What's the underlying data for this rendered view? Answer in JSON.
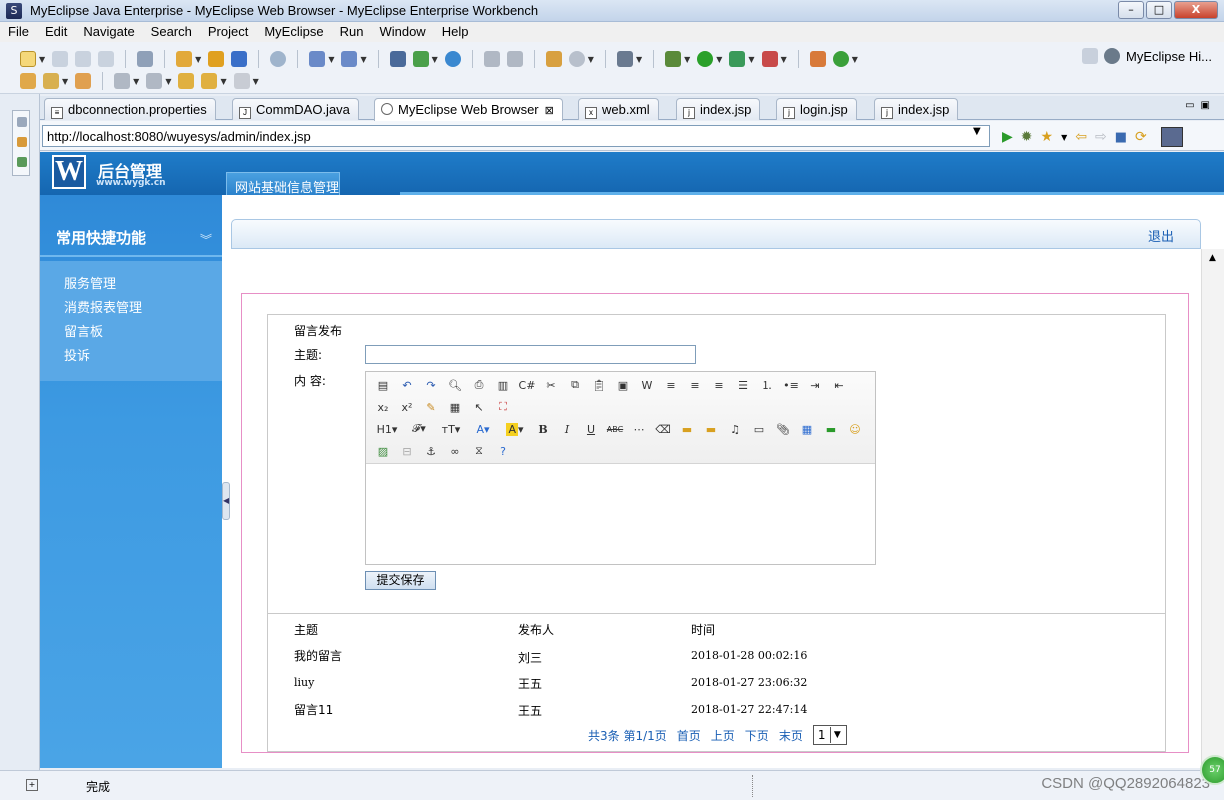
{
  "window": {
    "title": "MyEclipse Java Enterprise - MyEclipse Web Browser - MyEclipse Enterprise Workbench",
    "min": "–",
    "max": "□",
    "close": "X"
  },
  "menu": [
    "File",
    "Edit",
    "Navigate",
    "Search",
    "Project",
    "MyEclipse",
    "Run",
    "Window",
    "Help"
  ],
  "perspective": "MyEclipse Hi...",
  "tabs": [
    {
      "label": "dbconnection.properties",
      "icon": "properties-file-icon"
    },
    {
      "label": "CommDAO.java",
      "icon": "java-file-icon"
    },
    {
      "label": "MyEclipse Web Browser",
      "icon": "globe-icon",
      "active": true
    },
    {
      "label": "web.xml",
      "icon": "xml-file-icon"
    },
    {
      "label": "index.jsp",
      "icon": "jsp-file-icon"
    },
    {
      "label": "login.jsp",
      "icon": "jsp-file-icon"
    },
    {
      "label": "index.jsp",
      "icon": "jsp-file-icon"
    }
  ],
  "browser": {
    "url": "http://localhost:8080/wuyesys/admin/index.jsp"
  },
  "site": {
    "logo_letter": "W",
    "logo_title": "后台管理",
    "logo_sub": "www.wygk.cn",
    "nav_tab": "网站基础信息管理",
    "sidebar_title": "常用快捷功能",
    "sidebar_items": [
      "服务管理",
      "消费报表管理",
      "留言板",
      "投诉"
    ],
    "logout": "退出"
  },
  "form": {
    "title": "留言发布",
    "subject_label": "主题:",
    "subject_value": "",
    "content_label": "内 容:",
    "submit": "提交保存"
  },
  "table": {
    "headers": [
      "主题",
      "发布人",
      "时间"
    ],
    "rows": [
      {
        "subject": "我的留言",
        "author": "刘三",
        "time": "2018-01-28 00:02:16"
      },
      {
        "subject": "liuy",
        "author": "王五",
        "time": "2018-01-27 23:06:32"
      },
      {
        "subject": "留言11",
        "author": "王五",
        "time": "2018-01-27 22:47:14"
      }
    ]
  },
  "pager": {
    "summary": "共3条 第1/1页",
    "first": "首页",
    "prev": "上页",
    "next": "下页",
    "last": "末页",
    "page_select": "1"
  },
  "status": {
    "text": "完成",
    "watermark": "CSDN @QQ2892064823",
    "badge": "57"
  },
  "colors": {
    "header_blue": "#1f7cc9",
    "sidebar_blue": "#3d9ae2",
    "link_blue": "#1a5fb4",
    "frame_pink": "#e78fc6"
  }
}
